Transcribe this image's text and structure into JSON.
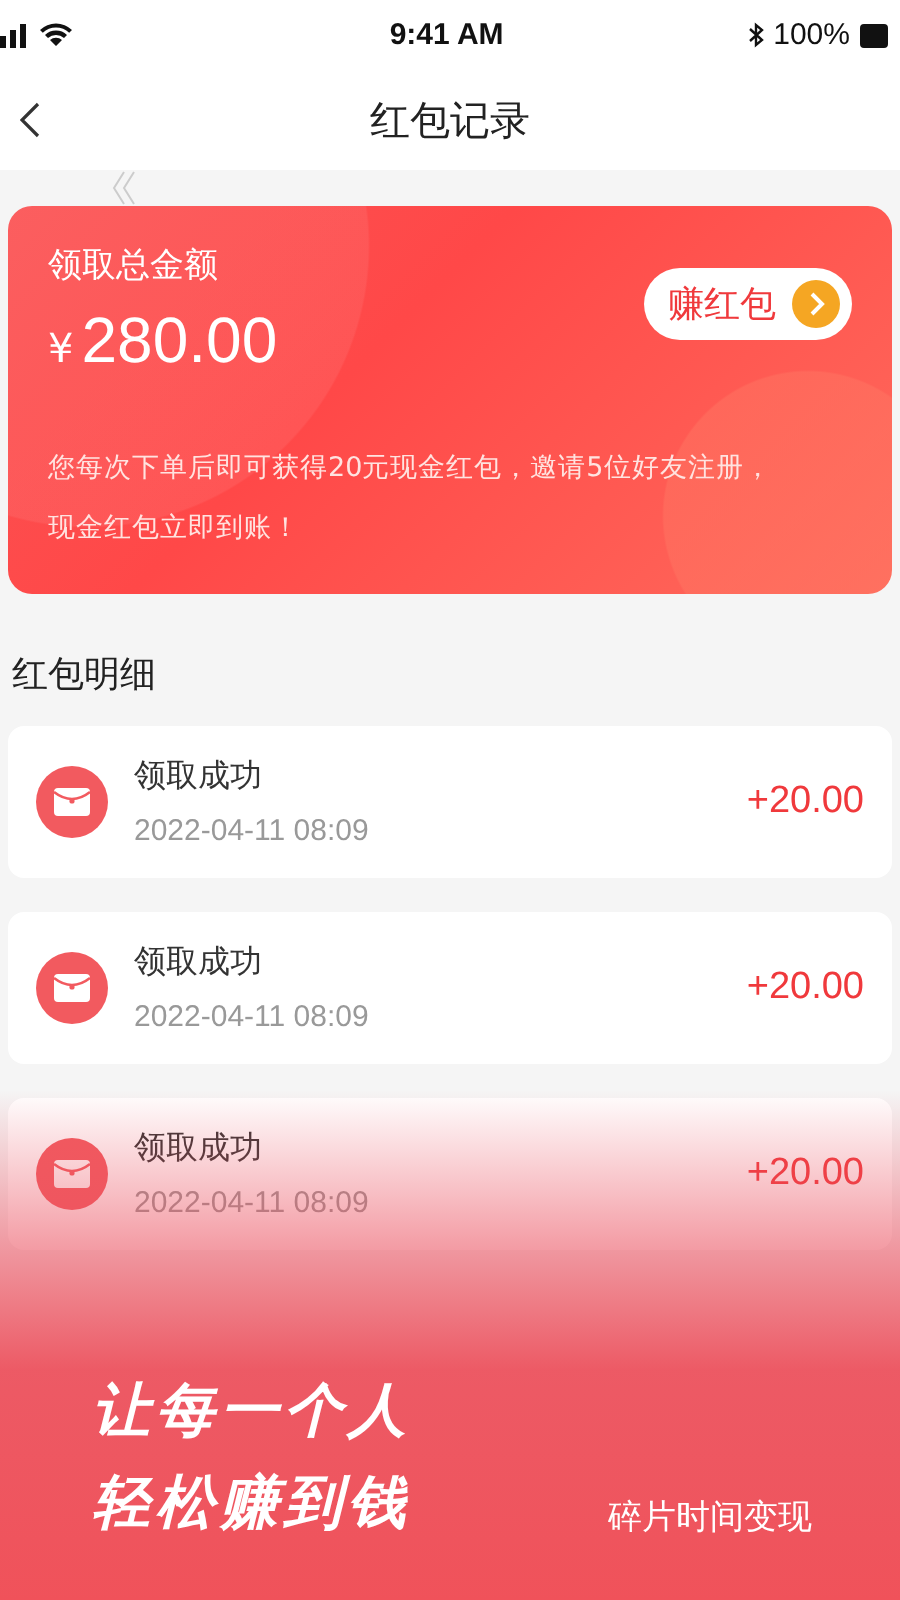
{
  "status_bar": {
    "time": "9:41 AM",
    "battery": "100%"
  },
  "nav": {
    "title": "红包记录"
  },
  "summary": {
    "label": "领取总金额",
    "currency": "¥",
    "amount": "280.00",
    "button": "赚红包",
    "note": "您每次下单后即可获得20元现金红包，邀请5位好友注册，现金红包立即到账！"
  },
  "section_title": "红包明细",
  "records": [
    {
      "title": "领取成功",
      "time": "2022-04-11 08:09",
      "amount": "+20.00"
    },
    {
      "title": "领取成功",
      "time": "2022-04-11 08:09",
      "amount": "+20.00"
    },
    {
      "title": "领取成功",
      "time": "2022-04-11 08:09",
      "amount": "+20.00"
    }
  ],
  "promo": {
    "slogan": [
      "让每一个人",
      "轻松赚到钱"
    ],
    "tagline": "碎片时间变现"
  }
}
